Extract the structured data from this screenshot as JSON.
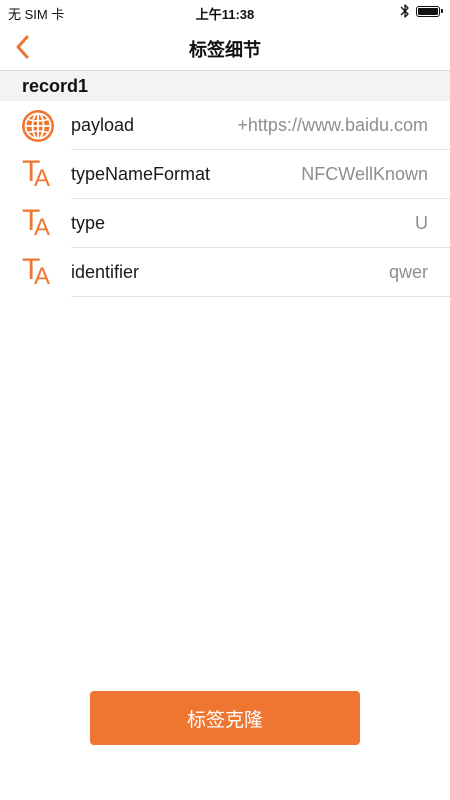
{
  "status_bar": {
    "carrier": "无 SIM 卡",
    "time": "上午11:38",
    "battery_level": 1.0
  },
  "nav": {
    "title": "标签细节",
    "back_icon": "chevron-left-icon"
  },
  "section": {
    "title": "record1"
  },
  "rows": [
    {
      "icon": "globe-icon",
      "label": "payload",
      "value": "+https://www.baidu.com"
    },
    {
      "icon": "text-format-icon",
      "label": "typeNameFormat",
      "value": "NFCWellKnown"
    },
    {
      "icon": "text-format-icon",
      "label": "type",
      "value": "U"
    },
    {
      "icon": "text-format-icon",
      "label": "identifier",
      "value": "qwer"
    }
  ],
  "footer": {
    "clone_label": "标签克隆"
  },
  "colors": {
    "accent": "#ee7631",
    "value_text": "#8e8e8e",
    "section_bg": "#f3f3f3"
  }
}
